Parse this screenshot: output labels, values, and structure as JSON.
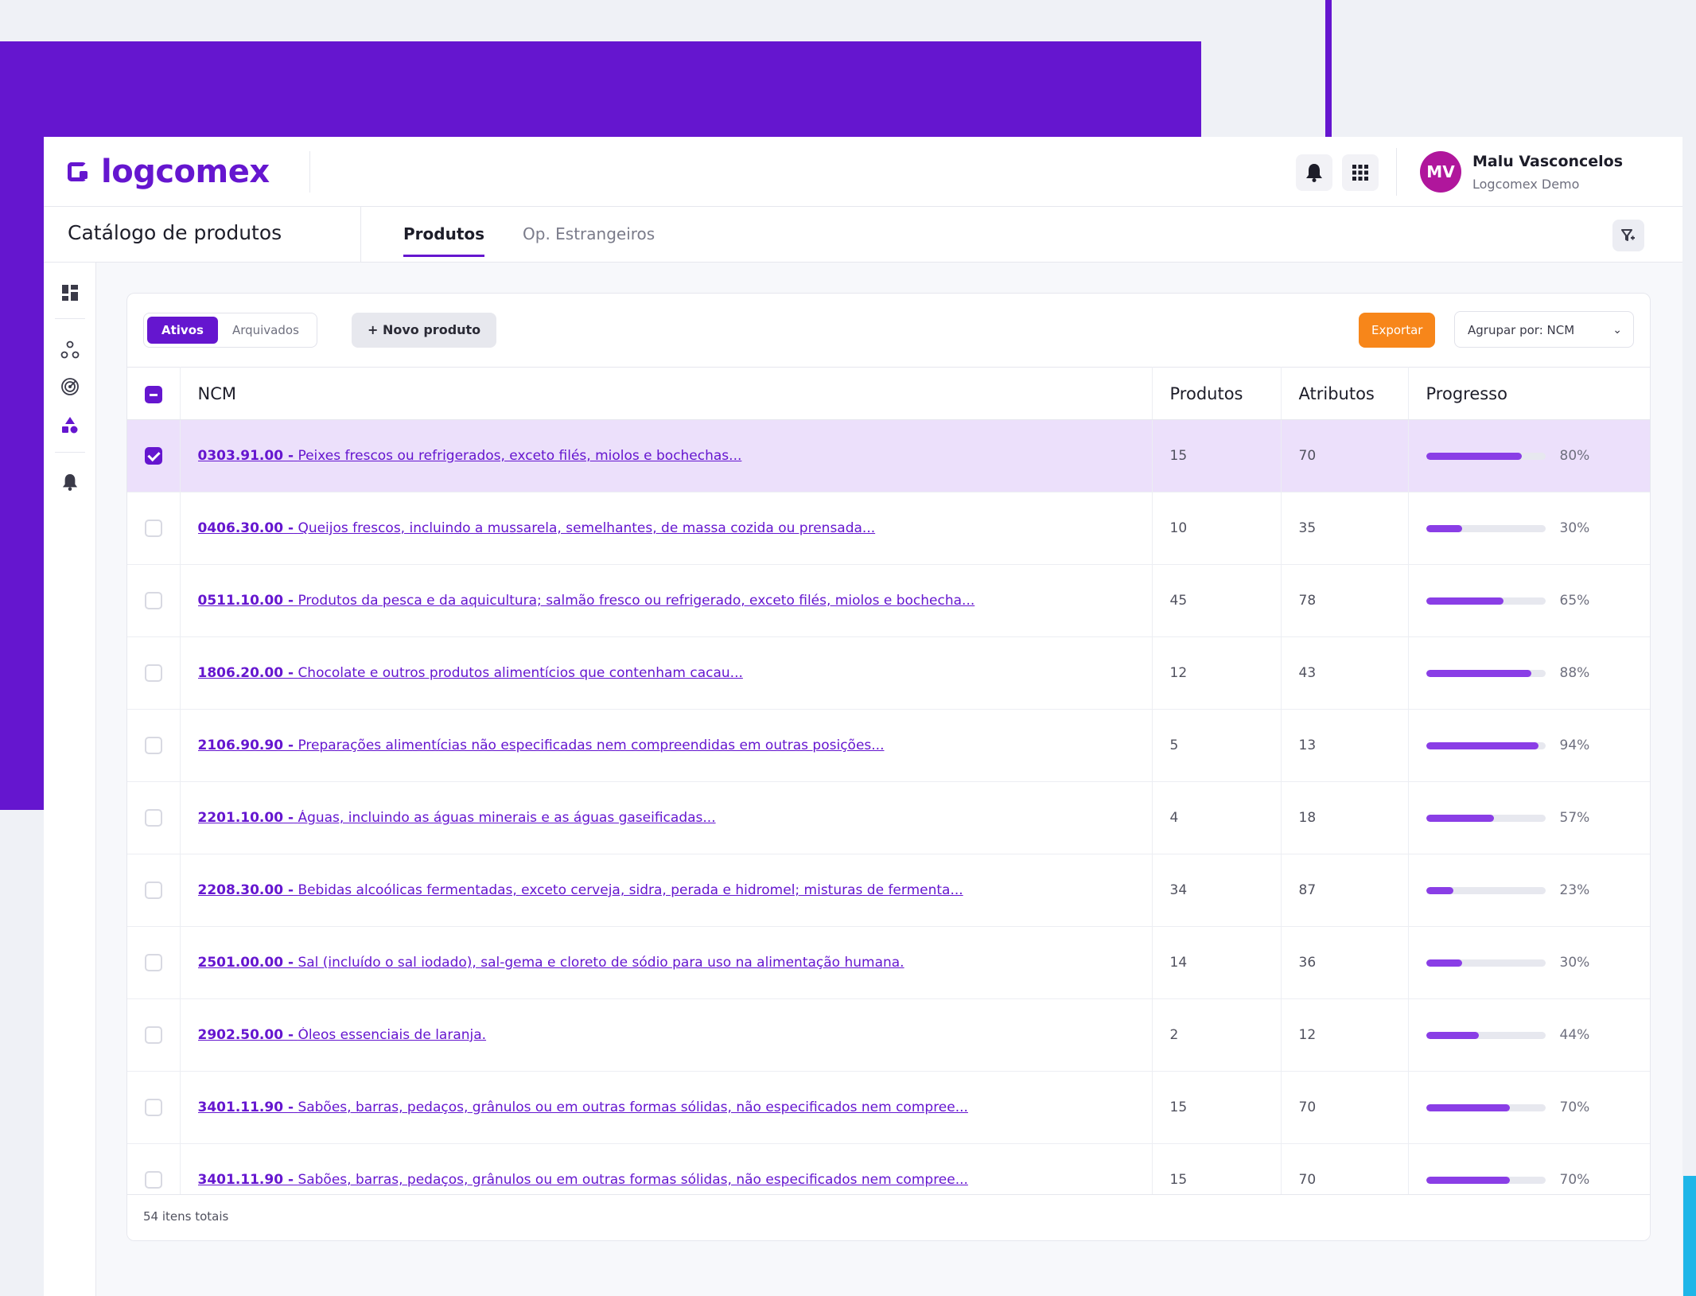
{
  "header": {
    "logo_text": "logcomex",
    "user_initials": "MV",
    "user_name": "Malu Vasconcelos",
    "user_org": "Logcomex Demo"
  },
  "subheader": {
    "page_title": "Catálogo de produtos",
    "tabs": [
      {
        "label": "Produtos",
        "active": true
      },
      {
        "label": "Op. Estrangeiros",
        "active": false
      }
    ]
  },
  "toolbar": {
    "segments": [
      {
        "label": "Ativos",
        "active": true
      },
      {
        "label": "Arquivados",
        "active": false
      }
    ],
    "new_product_label": "+  Novo produto",
    "export_label": "Exportar",
    "group_by_label": "Agrupar por: NCM"
  },
  "table": {
    "columns": [
      "NCM",
      "Produtos",
      "Atributos",
      "Progresso"
    ],
    "rows": [
      {
        "code": "0303.91.00 -",
        "desc": "Peixes frescos ou refrigerados, exceto filés, miolos e bochechas...",
        "produtos": "15",
        "atributos": "70",
        "progress": 80,
        "progress_label": "80%",
        "selected": true
      },
      {
        "code": "0406.30.00 -",
        "desc": "Queijos frescos, incluindo a mussarela, semelhantes, de massa cozida ou prensada...",
        "produtos": "10",
        "atributos": "35",
        "progress": 30,
        "progress_label": "30%",
        "selected": false
      },
      {
        "code": "0511.10.00 -",
        "desc": "Produtos da pesca e da aquicultura; salmão fresco ou refrigerado, exceto filés, miolos e bochecha...",
        "produtos": "45",
        "atributos": "78",
        "progress": 65,
        "progress_label": "65%",
        "selected": false
      },
      {
        "code": "1806.20.00 -",
        "desc": "Chocolate e outros produtos alimentícios que contenham cacau...",
        "produtos": "12",
        "atributos": "43",
        "progress": 88,
        "progress_label": "88%",
        "selected": false
      },
      {
        "code": "2106.90.90 -",
        "desc": "Preparações alimentícias não especificadas nem compreendidas em outras posições...",
        "produtos": "5",
        "atributos": "13",
        "progress": 94,
        "progress_label": "94%",
        "selected": false
      },
      {
        "code": "2201.10.00 -",
        "desc": "Águas, incluindo as águas minerais e as águas gaseificadas...",
        "produtos": "4",
        "atributos": "18",
        "progress": 57,
        "progress_label": "57%",
        "selected": false
      },
      {
        "code": "2208.30.00 -",
        "desc": "Bebidas alcoólicas fermentadas, exceto cerveja, sidra, perada e hidromel; misturas de fermenta...",
        "produtos": "34",
        "atributos": "87",
        "progress": 23,
        "progress_label": "23%",
        "selected": false
      },
      {
        "code": "2501.00.00 -",
        "desc": "Sal (incluído o sal iodado), sal-gema e cloreto de sódio para uso na alimentação humana.",
        "produtos": "14",
        "atributos": "36",
        "progress": 30,
        "progress_label": "30%",
        "selected": false
      },
      {
        "code": "2902.50.00 -",
        "desc": "Óleos essenciais de laranja.",
        "produtos": "2",
        "atributos": "12",
        "progress": 44,
        "progress_label": "44%",
        "selected": false
      },
      {
        "code": "3401.11.90 -",
        "desc": "Sabões, barras, pedaços, grânulos ou em outras formas sólidas, não especificados nem compree...",
        "produtos": "15",
        "atributos": "70",
        "progress": 70,
        "progress_label": "70%",
        "selected": false
      },
      {
        "code": "3401.11.90 -",
        "desc": "Sabões, barras, pedaços, grânulos ou em outras formas sólidas, não especificados nem compree...",
        "produtos": "15",
        "atributos": "70",
        "progress": 70,
        "progress_label": "70%",
        "selected": false
      }
    ]
  },
  "footer": {
    "total_label": "54 itens totais"
  },
  "colors": {
    "brand_purple": "#6516cf",
    "export_orange": "#f7861a",
    "avatar_magenta": "#b0169c",
    "progress_fill": "#8a3ee6",
    "selected_row": "#ece0fb"
  },
  "icons": {
    "notifications": "bell-icon",
    "apps": "grid-icon",
    "filter": "filter-icon",
    "sidebar": [
      "dashboard-icon",
      "nodes-icon",
      "radar-icon",
      "shapes-icon",
      "bell-icon"
    ]
  }
}
